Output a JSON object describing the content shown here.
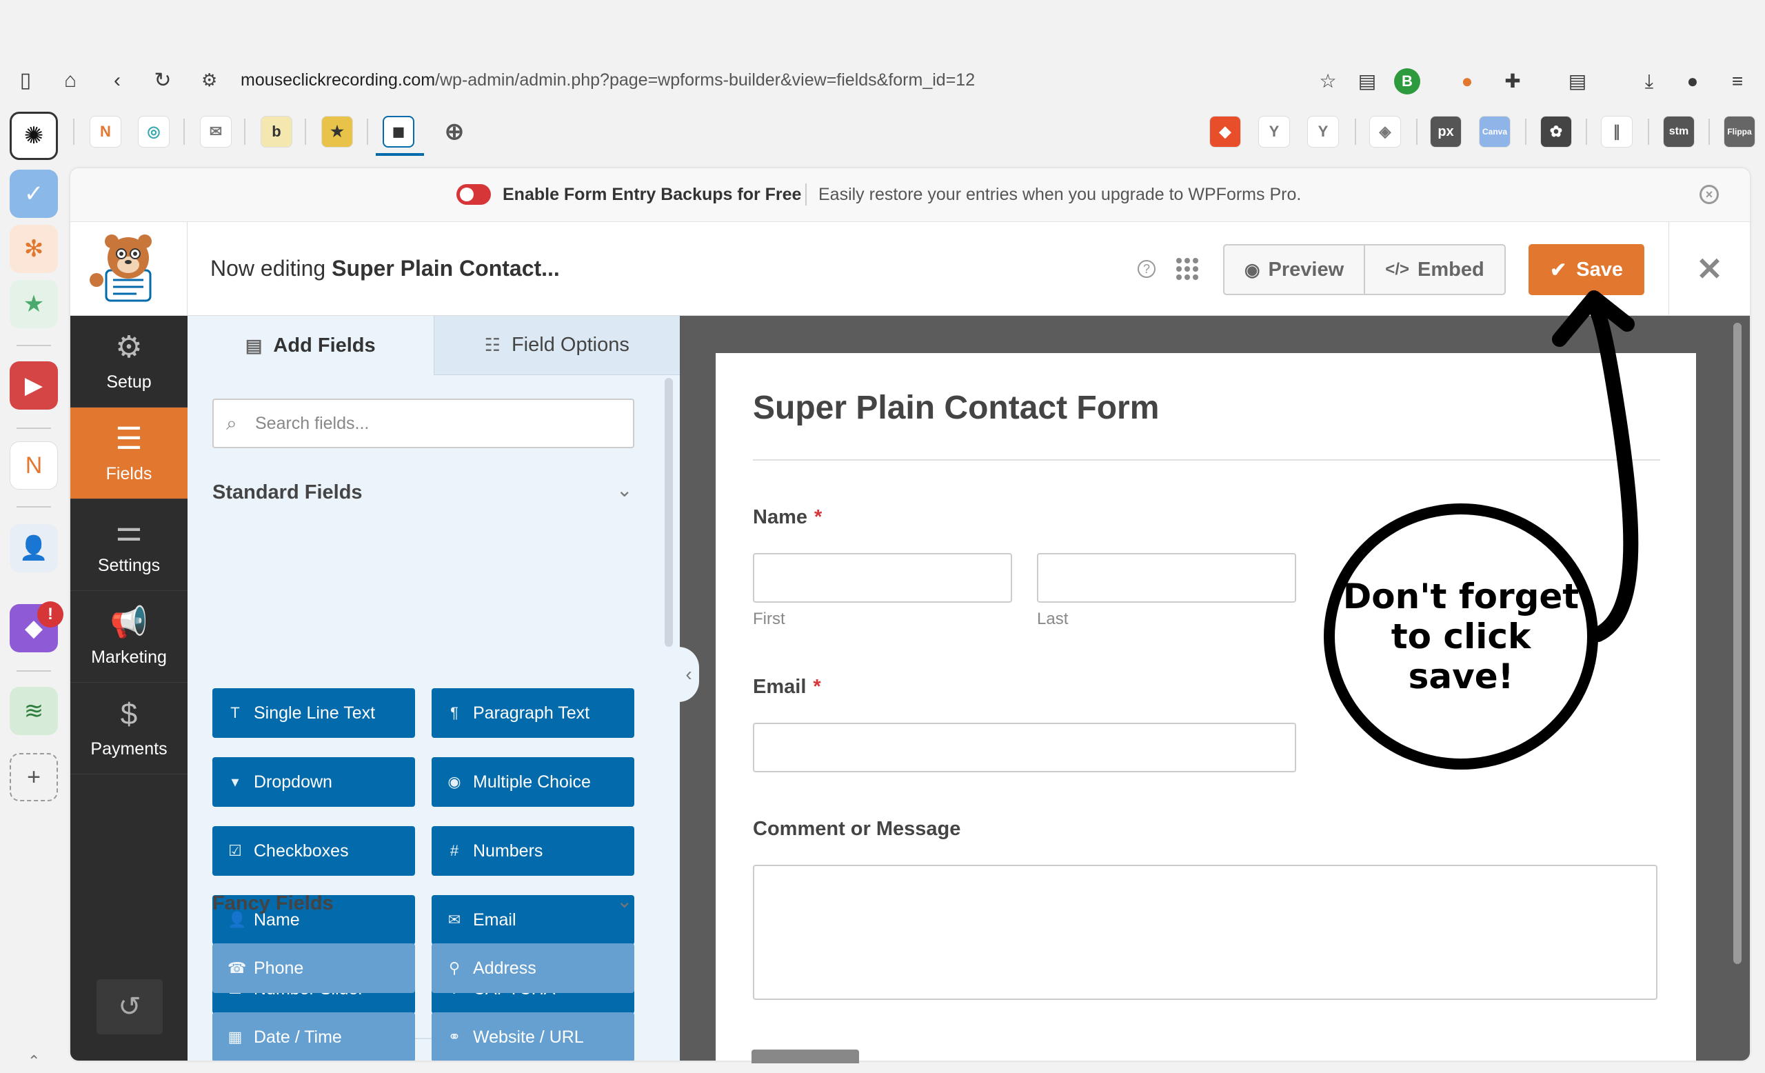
{
  "browser": {
    "url": "mouseclickrecording.com",
    "url_path": "/wp-admin/admin.php?page=wpforms-builder&view=fields&form_id=12",
    "profile_initial": "B"
  },
  "bookmarks": [
    "N",
    "b",
    "px",
    "stm",
    "Flippa",
    "Canva"
  ],
  "notice": {
    "title": "Enable Form Entry Backups for Free",
    "text": "Easily restore your entries when you upgrade to WPForms Pro."
  },
  "header": {
    "editing_prefix": "Now editing",
    "form_name": "Super Plain Contact...",
    "help": "?",
    "preview_label": "Preview",
    "embed_label": "Embed",
    "save_label": "Save"
  },
  "sidebar": {
    "items": [
      {
        "label": "Setup",
        "icon": "gear-icon",
        "active": false
      },
      {
        "label": "Fields",
        "icon": "fields-icon",
        "active": true
      },
      {
        "label": "Settings",
        "icon": "sliders-icon",
        "active": false
      },
      {
        "label": "Marketing",
        "icon": "megaphone-icon",
        "active": false
      },
      {
        "label": "Payments",
        "icon": "dollar-icon",
        "active": false
      }
    ]
  },
  "panel": {
    "tab_add": "Add Fields",
    "tab_options": "Field Options",
    "search_placeholder": "Search fields...",
    "standard_title": "Standard Fields",
    "fancy_title": "Fancy Fields",
    "standard_fields": [
      {
        "label": "Single Line Text",
        "icon": "T"
      },
      {
        "label": "Paragraph Text",
        "icon": "¶"
      },
      {
        "label": "Dropdown",
        "icon": "▾"
      },
      {
        "label": "Multiple Choice",
        "icon": "◉"
      },
      {
        "label": "Checkboxes",
        "icon": "☑"
      },
      {
        "label": "Numbers",
        "icon": "#"
      },
      {
        "label": "Name",
        "icon": "👤"
      },
      {
        "label": "Email",
        "icon": "✉"
      },
      {
        "label": "Number Slider",
        "icon": "☰"
      },
      {
        "label": "CAPTCHA",
        "icon": "?"
      }
    ],
    "fancy_fields": [
      {
        "label": "Phone",
        "icon": "☎"
      },
      {
        "label": "Address",
        "icon": "⚲"
      },
      {
        "label": "Date / Time",
        "icon": "▦"
      },
      {
        "label": "Website / URL",
        "icon": "⚭"
      }
    ]
  },
  "form": {
    "title": "Super Plain Contact Form",
    "name_label": "Name",
    "required_mark": "*",
    "first_label": "First",
    "last_label": "Last",
    "email_label": "Email",
    "message_label": "Comment or Message"
  },
  "annotation": {
    "line1": "Don't forget",
    "line2": "to click save!"
  }
}
